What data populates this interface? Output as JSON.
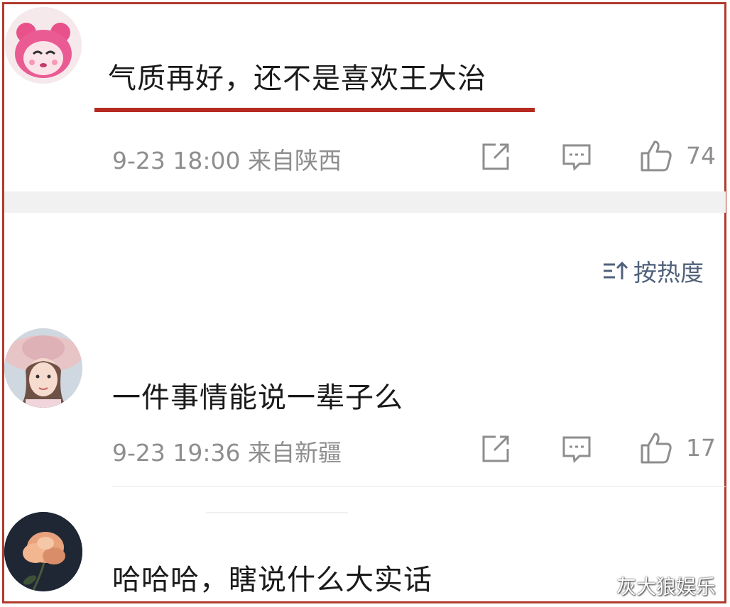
{
  "comments": [
    {
      "text": "气质再好，还不是喜欢王大治",
      "meta": "9-23 18:00 来自陕西",
      "likes": "74",
      "avatar_icon": "pink-cartoon-avatar"
    },
    {
      "text": "一件事情能说一辈子么",
      "meta": "9-23 19:36 来自新疆",
      "likes": "17",
      "avatar_icon": "woman-hat-avatar"
    },
    {
      "text": "哈哈哈，瞎说什么大实话",
      "avatar_icon": "flower-avatar"
    }
  ],
  "sort": {
    "label": "按热度",
    "icon": "sort-icon"
  },
  "watermark": "灰大狼娱乐",
  "colors": {
    "highlight_underline": "#b62a22",
    "frame": "#b03a2e",
    "meta_text": "#8e8e8e",
    "sort_text": "#50617a"
  }
}
